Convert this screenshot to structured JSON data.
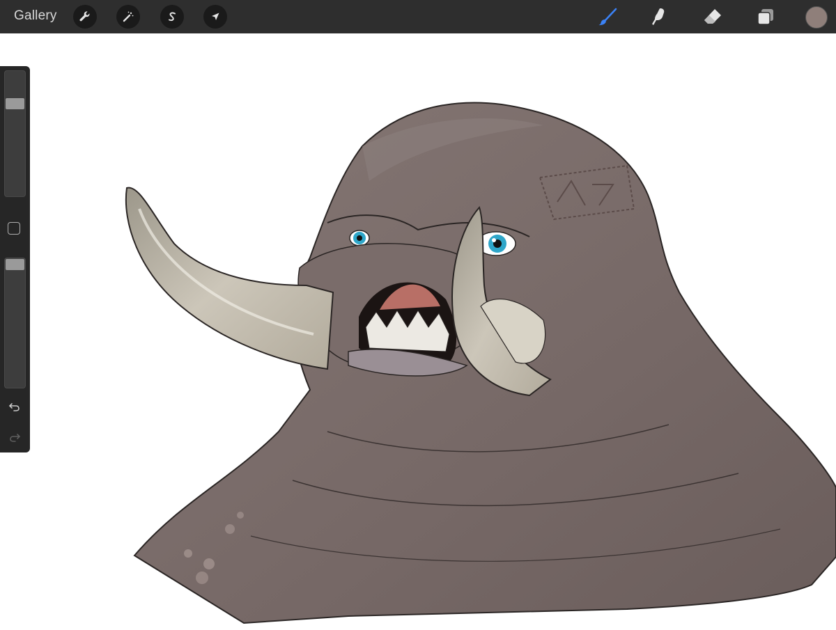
{
  "toolbar": {
    "gallery_label": "Gallery",
    "left_tools": [
      {
        "icon": "wrench-icon",
        "name": "actions"
      },
      {
        "icon": "magic-wand-icon",
        "name": "adjustments"
      },
      {
        "icon": "selection-s-icon",
        "name": "selection"
      },
      {
        "icon": "arrow-cursor-icon",
        "name": "transform"
      }
    ],
    "right_tools": [
      {
        "icon": "brush-icon",
        "name": "paint",
        "active": true
      },
      {
        "icon": "smudge-finger-icon",
        "name": "smudge",
        "active": false
      },
      {
        "icon": "eraser-icon",
        "name": "erase",
        "active": false
      },
      {
        "icon": "layers-icon",
        "name": "layers",
        "active": false
      }
    ],
    "current_color": "#8f7f7a",
    "active_tool_color": "#3b82f6"
  },
  "sidebar": {
    "brush_size_level": 0.77,
    "opacity_level": 1.0,
    "icons": [
      "modify-square-icon",
      "undo-icon",
      "redo-icon"
    ]
  },
  "canvas": {
    "background": "#ffffff",
    "artwork": "walrus-creature-illustration"
  }
}
